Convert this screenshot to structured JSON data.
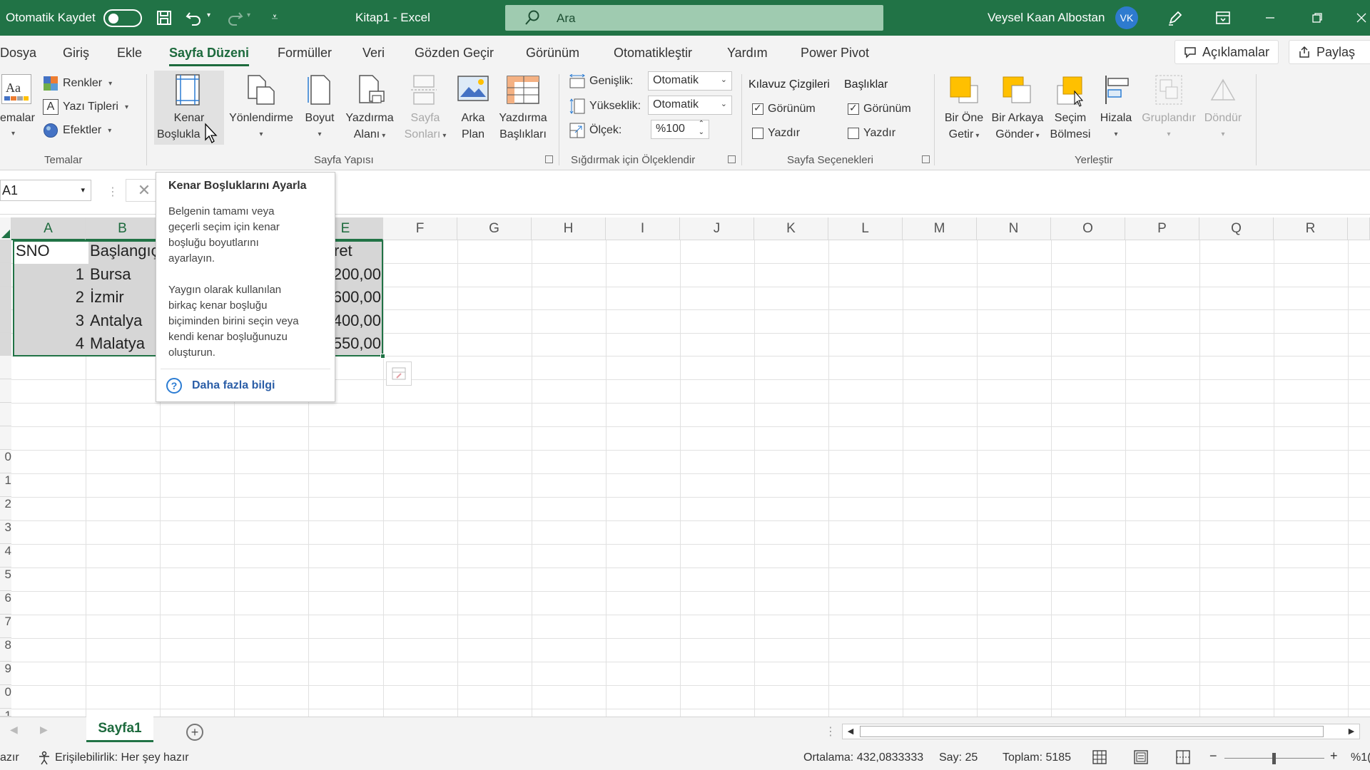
{
  "titlebar": {
    "autosave_label": "Otomatik Kaydet",
    "title": "Kitap1  -  Excel",
    "search_placeholder": "Ara",
    "user_name": "Veysel Kaan Albostan",
    "user_initials": "VK",
    "bg_color": "#217346"
  },
  "menu": {
    "tabs": [
      "Dosya",
      "Giriş",
      "Ekle",
      "Sayfa Düzeni",
      "Formüller",
      "Veri",
      "Gözden Geçir",
      "Görünüm",
      "Otomatikleştir",
      "Yardım",
      "Power Pivot"
    ],
    "active_tab": "Sayfa Düzeni",
    "comments": "Açıklamalar",
    "share": "Paylaş"
  },
  "ribbon": {
    "temalar": {
      "themes_label": "emalar",
      "colors": "Renkler",
      "fonts": "Yazı Tipleri",
      "effects": "Efektler",
      "group": "Temalar"
    },
    "sayfa_yapisi": {
      "margins": [
        "Kenar",
        "Boşlukla"
      ],
      "orientation": "Yönlendirme",
      "size": "Boyut",
      "print_area": [
        "Yazdırma",
        "Alanı"
      ],
      "breaks": [
        "Sayfa",
        "Sonları"
      ],
      "background": [
        "Arka",
        "Plan"
      ],
      "print_titles": [
        "Yazdırma",
        "Başlıkları"
      ],
      "group": "Sayfa Yapısı"
    },
    "sigdir": {
      "width_label": "Genişlik:",
      "width_value": "Otomatik",
      "height_label": "Yükseklik:",
      "height_value": "Otomatik",
      "scale_label": "Ölçek:",
      "scale_value": "%100",
      "group": "Sığdırmak için Ölçeklendir"
    },
    "secenekler": {
      "gridlines": "Kılavuz Çizgileri",
      "headings": "Başlıklar",
      "view": "Görünüm",
      "print": "Yazdır",
      "gridlines_view": true,
      "gridlines_print": false,
      "headings_view": true,
      "headings_print": false,
      "group": "Sayfa Seçenekleri"
    },
    "yerlestir": {
      "bring_forward": [
        "Bir Öne",
        "Getir"
      ],
      "send_backward": [
        "Bir Arkaya",
        "Gönder"
      ],
      "selection_pane": [
        "Seçim",
        "Bölmesi"
      ],
      "align": "Hizala",
      "group_btn": "Gruplandır",
      "rotate": "Döndür",
      "group": "Yerleştir"
    }
  },
  "formula_bar": {
    "name_box": "A1"
  },
  "grid": {
    "columns": [
      "A",
      "B",
      "",
      "",
      "E",
      "F",
      "G",
      "H",
      "I",
      "J",
      "K",
      "L",
      "M",
      "N",
      "O",
      "P",
      "Q",
      "R"
    ],
    "row_numbers": [
      "",
      "",
      "",
      "",
      "",
      "",
      "",
      "",
      "",
      "0",
      "1",
      "2",
      "3",
      "4",
      "5",
      "6",
      "7",
      "8",
      "9",
      "0",
      "1"
    ],
    "rows": [
      {
        "a": "SNO",
        "b": "Başlangıç",
        "e": "ret"
      },
      {
        "a": "1",
        "b": "Bursa",
        "e": "200,00"
      },
      {
        "a": "2",
        "b": "İzmir",
        "e": "600,00"
      },
      {
        "a": "3",
        "b": "Antalya",
        "e": "400,00"
      },
      {
        "a": "4",
        "b": "Malatya",
        "e": "550,00"
      }
    ]
  },
  "tooltip": {
    "title": "Kenar Boşluklarını Ayarla",
    "p1": "Belgenin tamamı veya\ngeçerli seçim için kenar\nboşluğu boyutlarını\nayarlayın.",
    "p2": "Yaygın olarak kullanılan\nbirkaç kenar boşluğu\nbiçiminden birini seçin veya\nkendi kenar boşluğunuzu\noluşturun.",
    "link": "Daha fazla bilgi"
  },
  "sheets": {
    "active": "Sayfa1"
  },
  "status": {
    "ready": "azır",
    "accessibility": "Erişilebilirlik: Her şey hazır",
    "average": "Ortalama: 432,0833333",
    "count": "Say: 25",
    "sum": "Toplam: 5185",
    "zoom": "%1("
  }
}
